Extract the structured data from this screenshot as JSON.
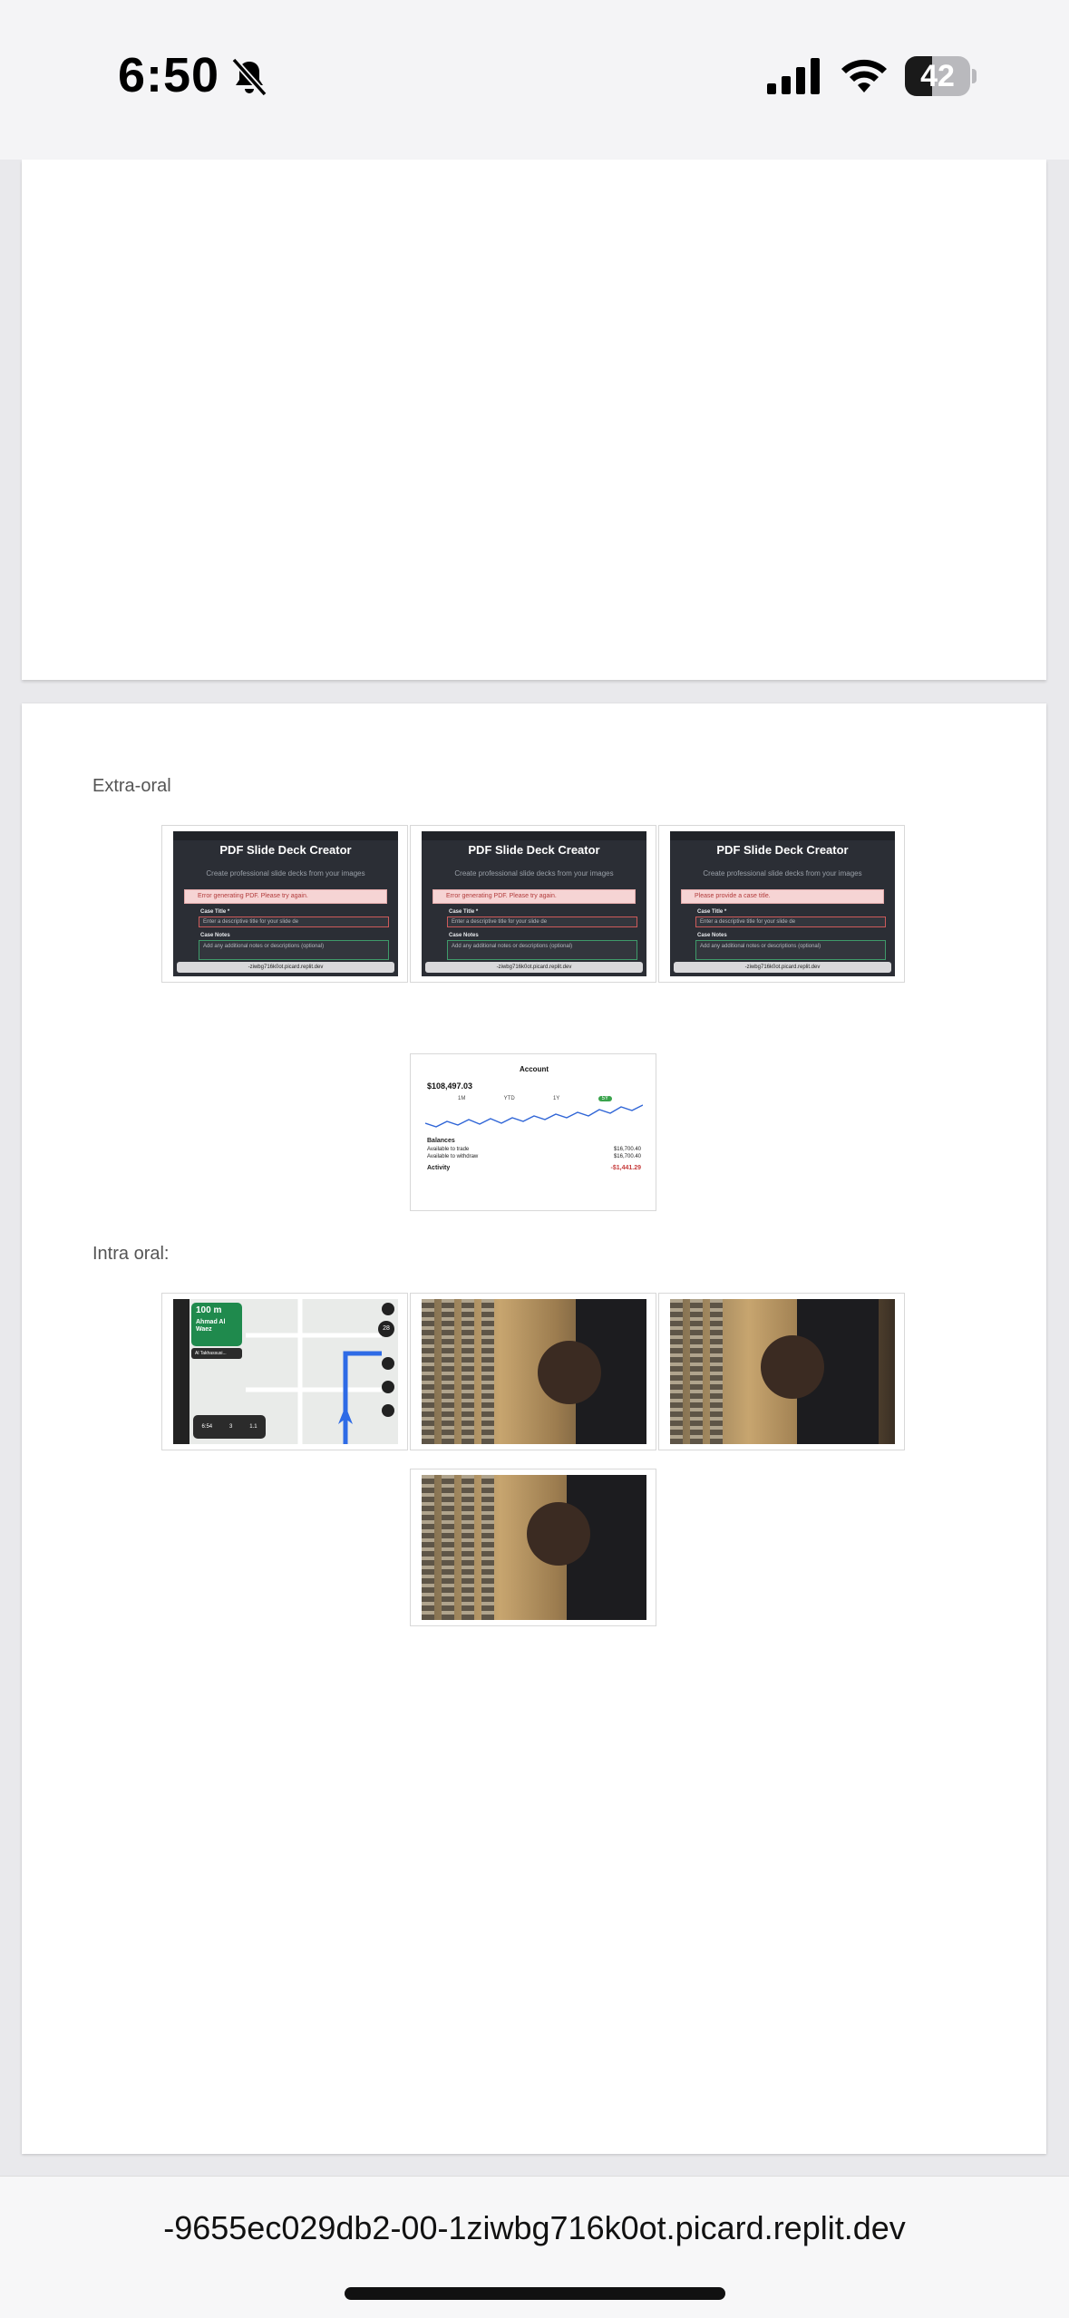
{
  "status_bar": {
    "time": "6:50",
    "battery": "42",
    "battery_level_percent": 42,
    "icons": [
      "bell-slash-icon",
      "cellular-signal-icon",
      "wifi-icon",
      "battery-icon"
    ]
  },
  "document": {
    "extra_oral_label": "Extra-oral",
    "intra_oral_label": "Intra oral:",
    "extra_oral_images": [
      {
        "title": "PDF Slide Deck Creator",
        "subtitle": "Create professional slide decks from your images",
        "alert": "Error generating PDF. Please try again.",
        "case_title_label": "Case Title *",
        "case_title_placeholder": "Enter a descriptive title for your slide de",
        "case_notes_label": "Case Notes",
        "case_notes_placeholder": "Add any additional notes or descriptions (optional)",
        "url": "-ziwbg716k0ot.picard.replit.dev"
      },
      {
        "title": "PDF Slide Deck Creator",
        "subtitle": "Create professional slide decks from your images",
        "alert": "Error generating PDF. Please try again.",
        "case_title_label": "Case Title *",
        "case_title_placeholder": "Enter a descriptive title for your slide de",
        "case_notes_label": "Case Notes",
        "case_notes_placeholder": "Add any additional notes or descriptions (optional)",
        "url": "-ziwbg716k0ot.picard.replit.dev"
      },
      {
        "title": "PDF Slide Deck Creator",
        "subtitle": "Create professional slide decks from your images",
        "alert": "Please provide a case title.",
        "case_title_label": "Case Title *",
        "case_title_placeholder": "Enter a descriptive title for your slide de",
        "case_notes_label": "Case Notes",
        "case_notes_placeholder": "Add any additional notes or descriptions (optional)",
        "url": "-ziwbg716k0ot.picard.replit.dev"
      }
    ],
    "account_image": {
      "header": "Account",
      "amount": "$108,497.03",
      "tabs": [
        "1M",
        "YTD",
        "1Y",
        "5Y"
      ],
      "balances_label": "Balances",
      "rows": [
        {
          "label": "Available to trade",
          "value": "$16,700.40"
        },
        {
          "label": "Available to withdraw",
          "value": "$16,700.40"
        }
      ],
      "activity_label": "Activity",
      "activity_value": "-$1,441.29"
    },
    "navigation_image": {
      "distance": "100 m",
      "street": "Ahmad Al Waez",
      "next_street": "Al Takhassusi...",
      "arrival": "6:54",
      "minutes": "3",
      "km": "1.1",
      "speed": "28"
    }
  },
  "browser": {
    "url": "-9655ec029db2-00-1ziwbg716k0ot.picard.replit.dev"
  }
}
